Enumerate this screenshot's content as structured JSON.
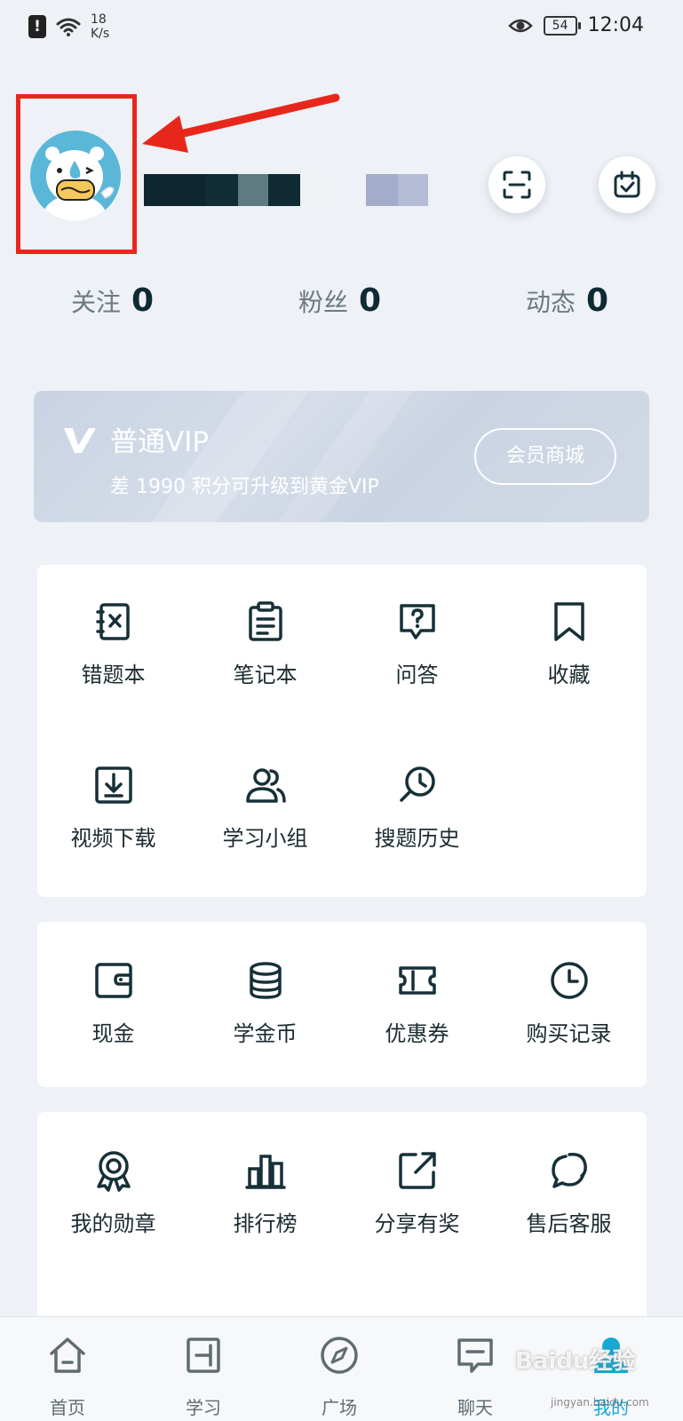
{
  "status_bar": {
    "alert_glyph": "!",
    "net_speed_value": "18",
    "net_speed_unit": "K/s",
    "battery": "54",
    "time": "12:04"
  },
  "header": {
    "counts": [
      {
        "label": "关注",
        "value": "0"
      },
      {
        "label": "粉丝",
        "value": "0"
      },
      {
        "label": "动态",
        "value": "0"
      }
    ]
  },
  "vip": {
    "title": "普通VIP",
    "subtitle": "差 1990 积分可升级到黄金VIP",
    "store_button": "会员商城"
  },
  "tools": {
    "items": [
      {
        "label": "错题本",
        "icon": "wrong-book-icon"
      },
      {
        "label": "笔记本",
        "icon": "notebook-icon"
      },
      {
        "label": "问答",
        "icon": "qa-icon"
      },
      {
        "label": "收藏",
        "icon": "bookmark-icon"
      },
      {
        "label": "视频下载",
        "icon": "download-icon"
      },
      {
        "label": "学习小组",
        "icon": "group-icon"
      },
      {
        "label": "搜题历史",
        "icon": "search-history-icon"
      }
    ]
  },
  "wallet": {
    "items": [
      {
        "label": "现金",
        "icon": "wallet-icon"
      },
      {
        "label": "学金币",
        "icon": "coins-icon"
      },
      {
        "label": "优惠券",
        "icon": "coupon-icon"
      },
      {
        "label": "购买记录",
        "icon": "clock-icon"
      }
    ]
  },
  "more": {
    "items": [
      {
        "label": "我的勋章",
        "icon": "medal-icon"
      },
      {
        "label": "排行榜",
        "icon": "ranking-icon"
      },
      {
        "label": "分享有奖",
        "icon": "share-icon"
      },
      {
        "label": "售后客服",
        "icon": "chat-bubbles-icon"
      }
    ]
  },
  "bottom_nav": {
    "items": [
      {
        "label": "首页",
        "icon": "home-icon"
      },
      {
        "label": "学习",
        "icon": "study-icon"
      },
      {
        "label": "广场",
        "icon": "compass-icon"
      },
      {
        "label": "聊天",
        "icon": "chat-icon"
      },
      {
        "label": "我的",
        "icon": "profile-icon",
        "active": true
      }
    ]
  },
  "watermark": {
    "text": "Baidu经验",
    "sub": "jingyan.baidu.com"
  },
  "colors": {
    "accent": "#15a9d4",
    "icon": "#173038",
    "annotation": "#e8271c",
    "vip_card": "#cdd6e5"
  }
}
